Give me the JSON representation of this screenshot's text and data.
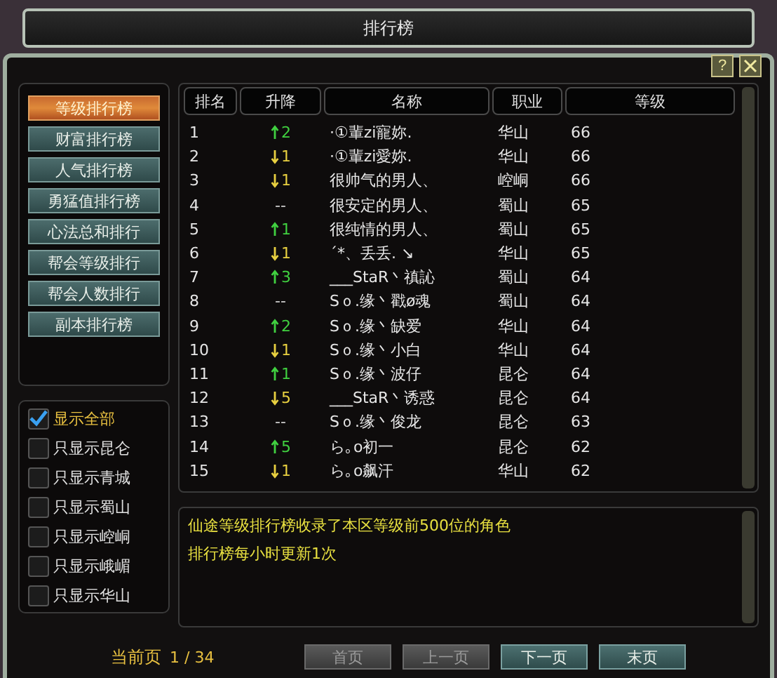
{
  "window": {
    "title": "排行榜",
    "help": "?"
  },
  "categories": [
    {
      "label": "等级排行榜",
      "selected": true
    },
    {
      "label": "财富排行榜",
      "selected": false
    },
    {
      "label": "人气排行榜",
      "selected": false
    },
    {
      "label": "勇猛值排行榜",
      "selected": false
    },
    {
      "label": "心法总和排行",
      "selected": false
    },
    {
      "label": "帮会等级排行",
      "selected": false
    },
    {
      "label": "帮会人数排行",
      "selected": false
    },
    {
      "label": "副本排行榜",
      "selected": false
    }
  ],
  "filters": [
    {
      "label": "显示全部",
      "checked": true
    },
    {
      "label": "只显示昆仑",
      "checked": false
    },
    {
      "label": "只显示青城",
      "checked": false
    },
    {
      "label": "只显示蜀山",
      "checked": false
    },
    {
      "label": "只显示崆峒",
      "checked": false
    },
    {
      "label": "只显示峨嵋",
      "checked": false
    },
    {
      "label": "只显示华山",
      "checked": false
    }
  ],
  "table": {
    "columns": [
      "排名",
      "升降",
      "名称",
      "职业",
      "等级"
    ],
    "rows": [
      {
        "rank": "1",
        "change": {
          "kind": "up",
          "amount": "2"
        },
        "name": "·①輩zi寵妳.",
        "class": "华山",
        "level": "66"
      },
      {
        "rank": "2",
        "change": {
          "kind": "down",
          "amount": "1"
        },
        "name": "·①輩zi愛妳.",
        "class": "华山",
        "level": "66"
      },
      {
        "rank": "3",
        "change": {
          "kind": "down",
          "amount": "1"
        },
        "name": "很帅气的男人、",
        "class": "崆峒",
        "level": "66"
      },
      {
        "rank": "4",
        "change": {
          "kind": "none",
          "amount": "--"
        },
        "name": "很安定的男人、",
        "class": "蜀山",
        "level": "65"
      },
      {
        "rank": "5",
        "change": {
          "kind": "up",
          "amount": "1"
        },
        "name": "很纯情的男人、",
        "class": "蜀山",
        "level": "65"
      },
      {
        "rank": "6",
        "change": {
          "kind": "down",
          "amount": "1"
        },
        "name": "´*、丢丢. ↘",
        "class": "华山",
        "level": "65"
      },
      {
        "rank": "7",
        "change": {
          "kind": "up",
          "amount": "3"
        },
        "name": "___StaR丶禛訫",
        "class": "蜀山",
        "level": "64"
      },
      {
        "rank": "8",
        "change": {
          "kind": "none",
          "amount": "--"
        },
        "name": "Sｏ.缘丶戳ø魂",
        "class": "蜀山",
        "level": "64"
      },
      {
        "rank": "9",
        "change": {
          "kind": "up",
          "amount": "2"
        },
        "name": "Sｏ.缘丶缺爱",
        "class": "华山",
        "level": "64"
      },
      {
        "rank": "10",
        "change": {
          "kind": "down",
          "amount": "1"
        },
        "name": "Sｏ.缘丶小白",
        "class": "华山",
        "level": "64"
      },
      {
        "rank": "11",
        "change": {
          "kind": "up",
          "amount": "1"
        },
        "name": "Sｏ.缘丶波仔",
        "class": "昆仑",
        "level": "64"
      },
      {
        "rank": "12",
        "change": {
          "kind": "down",
          "amount": "5"
        },
        "name": "___StaR丶诱惑",
        "class": "昆仑",
        "level": "64"
      },
      {
        "rank": "13",
        "change": {
          "kind": "none",
          "amount": "--"
        },
        "name": "Sｏ.缘丶俊龙",
        "class": "昆仑",
        "level": "63"
      },
      {
        "rank": "14",
        "change": {
          "kind": "up",
          "amount": "5"
        },
        "name": "ら｡o初一",
        "class": "昆仑",
        "level": "62"
      },
      {
        "rank": "15",
        "change": {
          "kind": "down",
          "amount": "1"
        },
        "name": "ら｡o飙汗",
        "class": "华山",
        "level": "62"
      }
    ]
  },
  "info": [
    "仙途等级排行榜收录了本区等级前500位的角色",
    "排行榜每小时更新1次"
  ],
  "pager": {
    "label": "当前页",
    "page": "1 / 34",
    "buttons": [
      {
        "label": "首页",
        "disabled": true
      },
      {
        "label": "上一页",
        "disabled": true
      },
      {
        "label": "下一页",
        "disabled": false
      },
      {
        "label": "末页",
        "disabled": false
      }
    ]
  }
}
